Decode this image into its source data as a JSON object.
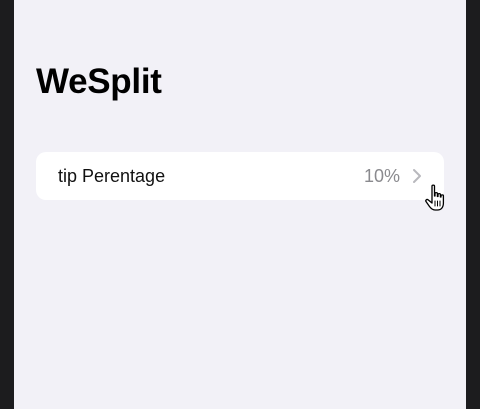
{
  "app": {
    "title": "WeSplit"
  },
  "form": {
    "tip_row": {
      "label": "tip Perentage",
      "value": "10%"
    }
  },
  "icons": {
    "chevron": "chevron-right-icon",
    "cursor": "hand-pointer-icon"
  },
  "colors": {
    "background": "#f2f1f7",
    "row_background": "#ffffff",
    "secondary_text": "#8a8a8e",
    "frame": "#1c1c1e"
  }
}
